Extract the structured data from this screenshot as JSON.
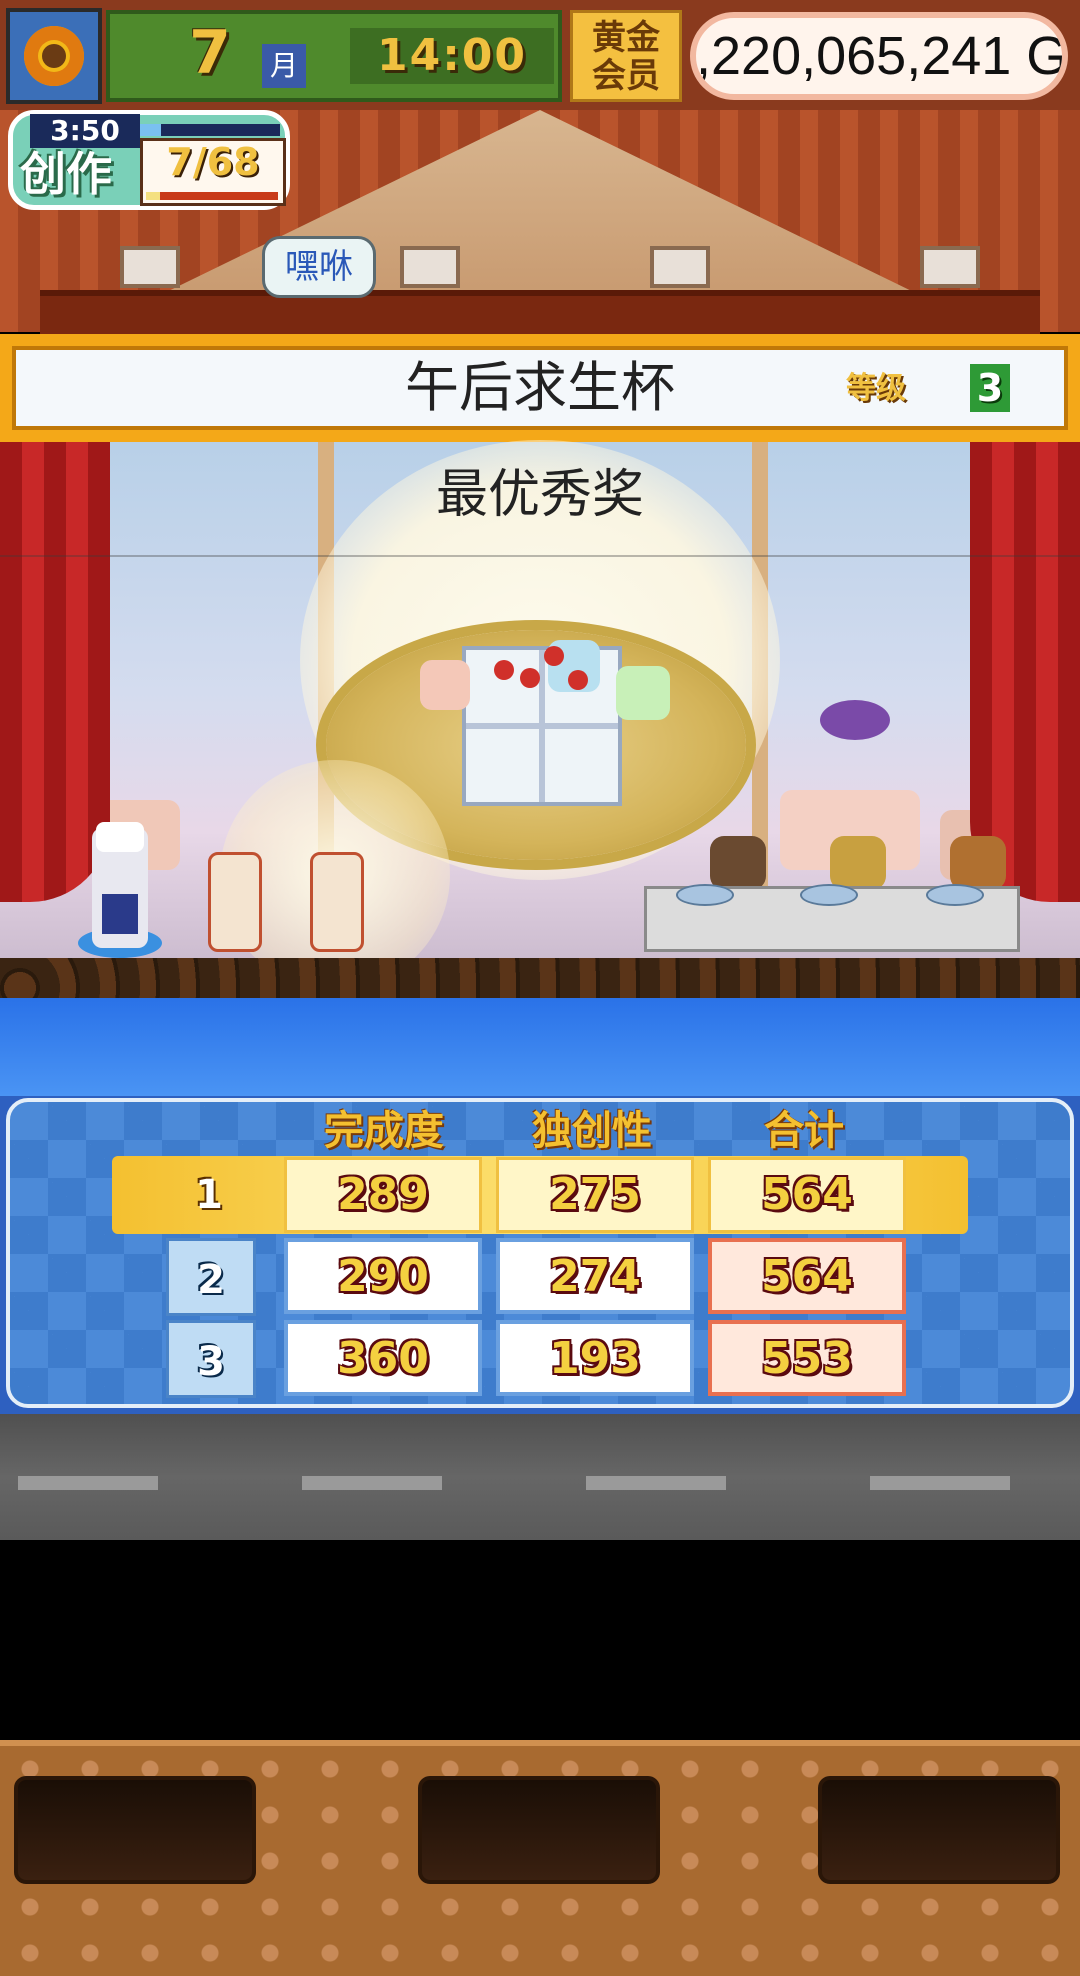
{
  "status_bar": {
    "month": "7",
    "month_label": "月",
    "time": "14:00",
    "member_label": "黄金会员",
    "money": ",220,065,241 G"
  },
  "creation": {
    "timer": "3:50",
    "label": "创作",
    "progress": "7/68",
    "progress_fraction": 0.103,
    "timer_fraction": 0.15
  },
  "speech_bubble": "嘿咻",
  "contest": {
    "name": "午后求生杯",
    "grade_label": "等级",
    "grade": "3"
  },
  "award": "最优秀奖",
  "score_table": {
    "headers": [
      "完成度",
      "独创性",
      "合计"
    ],
    "rows": [
      {
        "rank": "1",
        "completion": "289",
        "originality": "275",
        "total": "564"
      },
      {
        "rank": "2",
        "completion": "290",
        "originality": "274",
        "total": "564"
      },
      {
        "rank": "3",
        "completion": "360",
        "originality": "193",
        "total": "553"
      }
    ]
  },
  "icons": {
    "avatar": "sunflower-icon"
  },
  "colors": {
    "title_frame": "#f4a818",
    "score_board": "#4c8ad8",
    "first_place": "#f4c030"
  }
}
